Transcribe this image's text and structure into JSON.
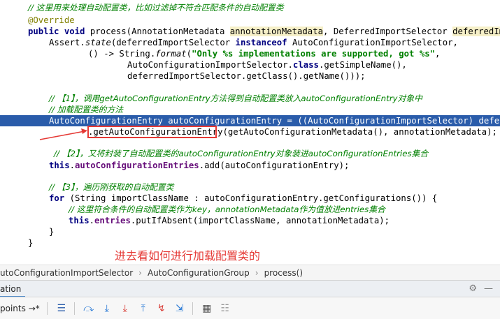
{
  "code": {
    "l1_comment": "// 这里用来处理自动配置类，比如过滤掉不符合匹配条件的自动配置类",
    "l2_annotation": "@Override",
    "l3_kw1": "public",
    "l3_kw2": "void",
    "l3_sig1": " process(AnnotationMetadata ",
    "l3_param1": "annotationMetadata",
    "l3_sig2": ", DeferredImportSelector ",
    "l3_param2": "deferredImport",
    "l4_a": "Assert.",
    "l4_state": "state",
    "l4_b": "(deferredImportSelector ",
    "l4_kw": "instanceof",
    "l4_c": " AutoConfigurationImportSelector,",
    "l5_a": "() -> String.",
    "l5_format": "format",
    "l5_b": "(",
    "l5_str": "\"Only %s implementations are supported, got %s\"",
    "l5_c": ",",
    "l6_a": "AutoConfigurationImportSelector.",
    "l6_kw": "class",
    "l6_b": ".getSimpleName(),",
    "l7": "deferredImportSelector.getClass().getName()));",
    "l9_comment": "// 【1】，调用getAutoConfigurationEntry方法得到自动配置类放入autoConfigurationEntry对象中",
    "l10_comment": "// 加载配置类的方法",
    "l11": "AutoConfigurationEntry autoConfigurationEntry = ((AutoConfigurationImportSelector) deferredIm",
    "l12_a": ".getAutoConfigurationEntry",
    "l12_b": "(getAutoConfigurationMetadata(), annotationMetadata);",
    "l14_comment": "// 【2】，又将封装了自动配置类的autoConfigurationEntry对象装进autoConfigurationEntries集合",
    "l15_kw": "this",
    "l15_a": ".",
    "l15_field": "autoConfigurationEntries",
    "l15_b": ".add(autoConfigurationEntry);",
    "l17_comment": "// 【3】，遍历刚获取的自动配置类",
    "l18_kw": "for",
    "l18_a": " (String importClassName : autoConfigurationEntry.getConfigurations()) {",
    "l19_comment": "// 这里符合条件的自动配置类作为key，annotationMetadata作为值放进entries集合",
    "l20_kw": "this",
    "l20_a": ".",
    "l20_field": "entries",
    "l20_b": ".putIfAbsent(importClassName, annotationMetadata);",
    "l21": "}",
    "l22": "}"
  },
  "annotation_text": "进去看如何进行加载配置类的",
  "breadcrumb": {
    "class_name": "utoConfigurationImportSelector",
    "group": "AutoConfigurationGroup",
    "method": "process()",
    "separator": "›"
  },
  "tool_window": {
    "tab_label": "ation"
  },
  "toolbar": {
    "label": "points",
    "label_suffix": "→*"
  },
  "colors": {
    "selection": "#2a5caa",
    "annotation_red": "#e53935",
    "comment_green": "#008000",
    "keyword_navy": "#000080",
    "field_purple": "#660e7a"
  }
}
